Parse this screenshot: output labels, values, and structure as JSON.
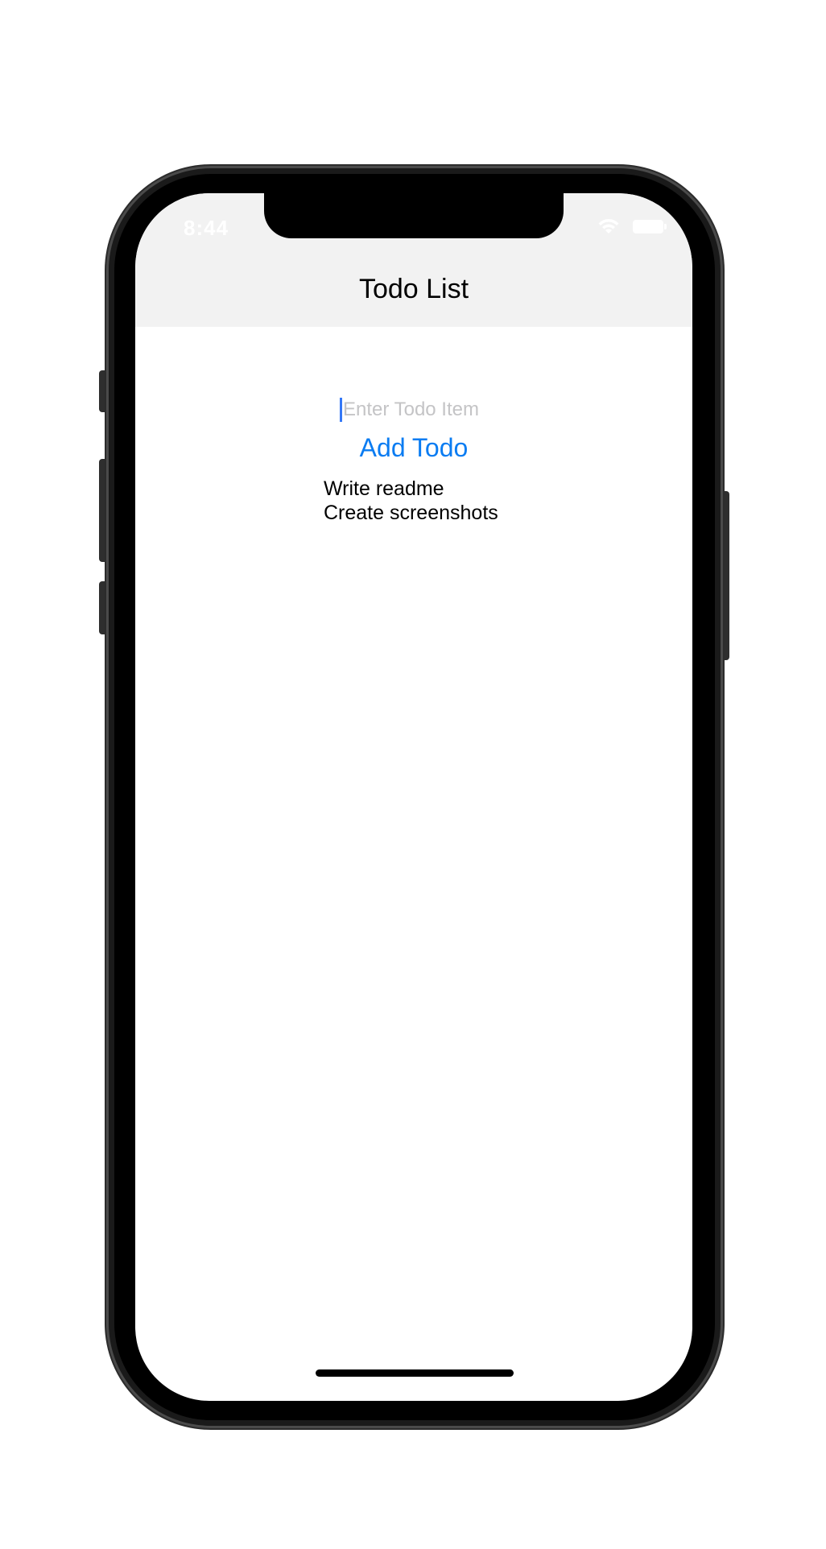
{
  "status_bar": {
    "time": "8:44",
    "wifi_icon": "wifi-icon",
    "battery_icon": "battery-icon"
  },
  "navbar": {
    "title": "Todo List"
  },
  "todo_input": {
    "placeholder": "Enter Todo Item",
    "value": ""
  },
  "add_button": {
    "label": "Add Todo"
  },
  "todos": [
    {
      "text": "Write readme"
    },
    {
      "text": "Create screenshots"
    }
  ],
  "colors": {
    "accent": "#0a7cf2",
    "navbar_background": "#f2f2f2",
    "placeholder": "#c4c4c6"
  }
}
